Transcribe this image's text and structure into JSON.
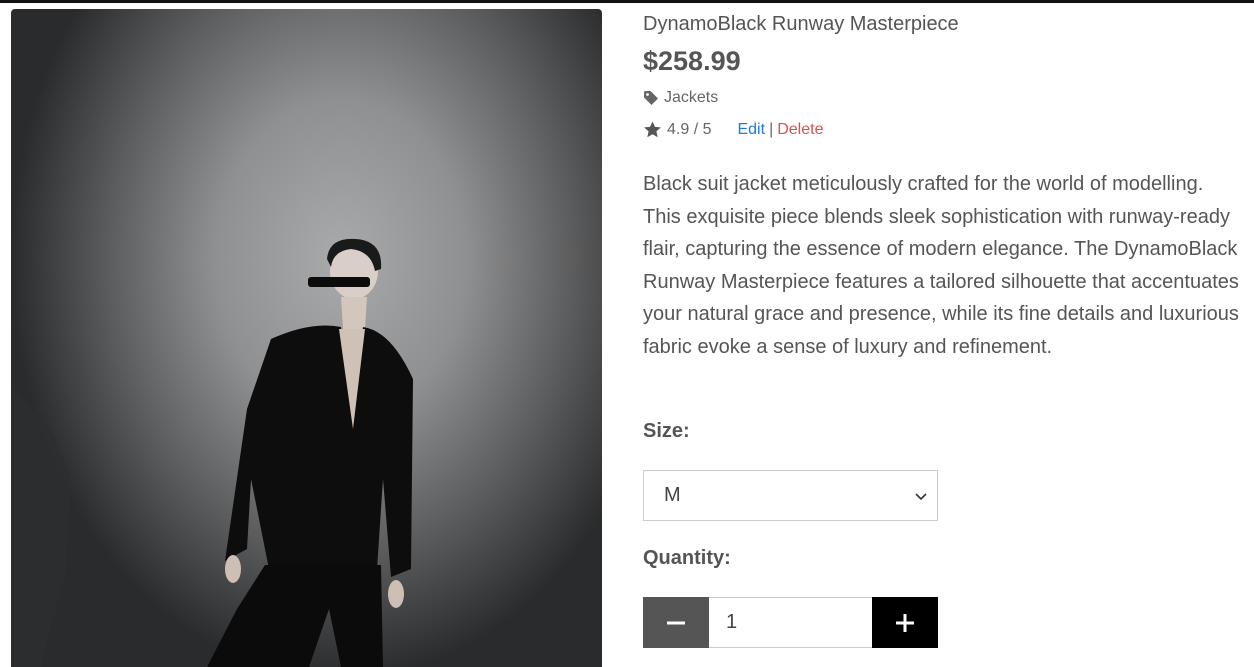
{
  "product": {
    "title": "DynamoBlack Runway Masterpiece",
    "price": "$258.99",
    "category": "Jackets",
    "rating": "4.9 / 5",
    "edit_label": "Edit",
    "separator": "|",
    "delete_label": "Delete",
    "description": "Black suit jacket meticulously crafted for the world of modelling. This exquisite piece blends sleek sophistication with runway-ready flair, capturing the essence of modern elegance. The DynamoBlack Runway Masterpiece features a tailored silhouette that accentuates your natural grace and presence, while its fine details and luxurious fabric evoke a sense of luxury and refinement."
  },
  "size": {
    "label": "Size:",
    "selected": "M"
  },
  "quantity": {
    "label": "Quantity:",
    "value": "1"
  },
  "icons": {
    "category": "tag-icon",
    "rating": "star-icon",
    "select": "chevron-down-icon",
    "decrement": "minus-icon",
    "increment": "plus-icon"
  },
  "colors": {
    "edit_link": "#1e7bd8",
    "delete_link": "#d9534f",
    "decrement_button": "#555555",
    "increment_button": "#000000"
  }
}
